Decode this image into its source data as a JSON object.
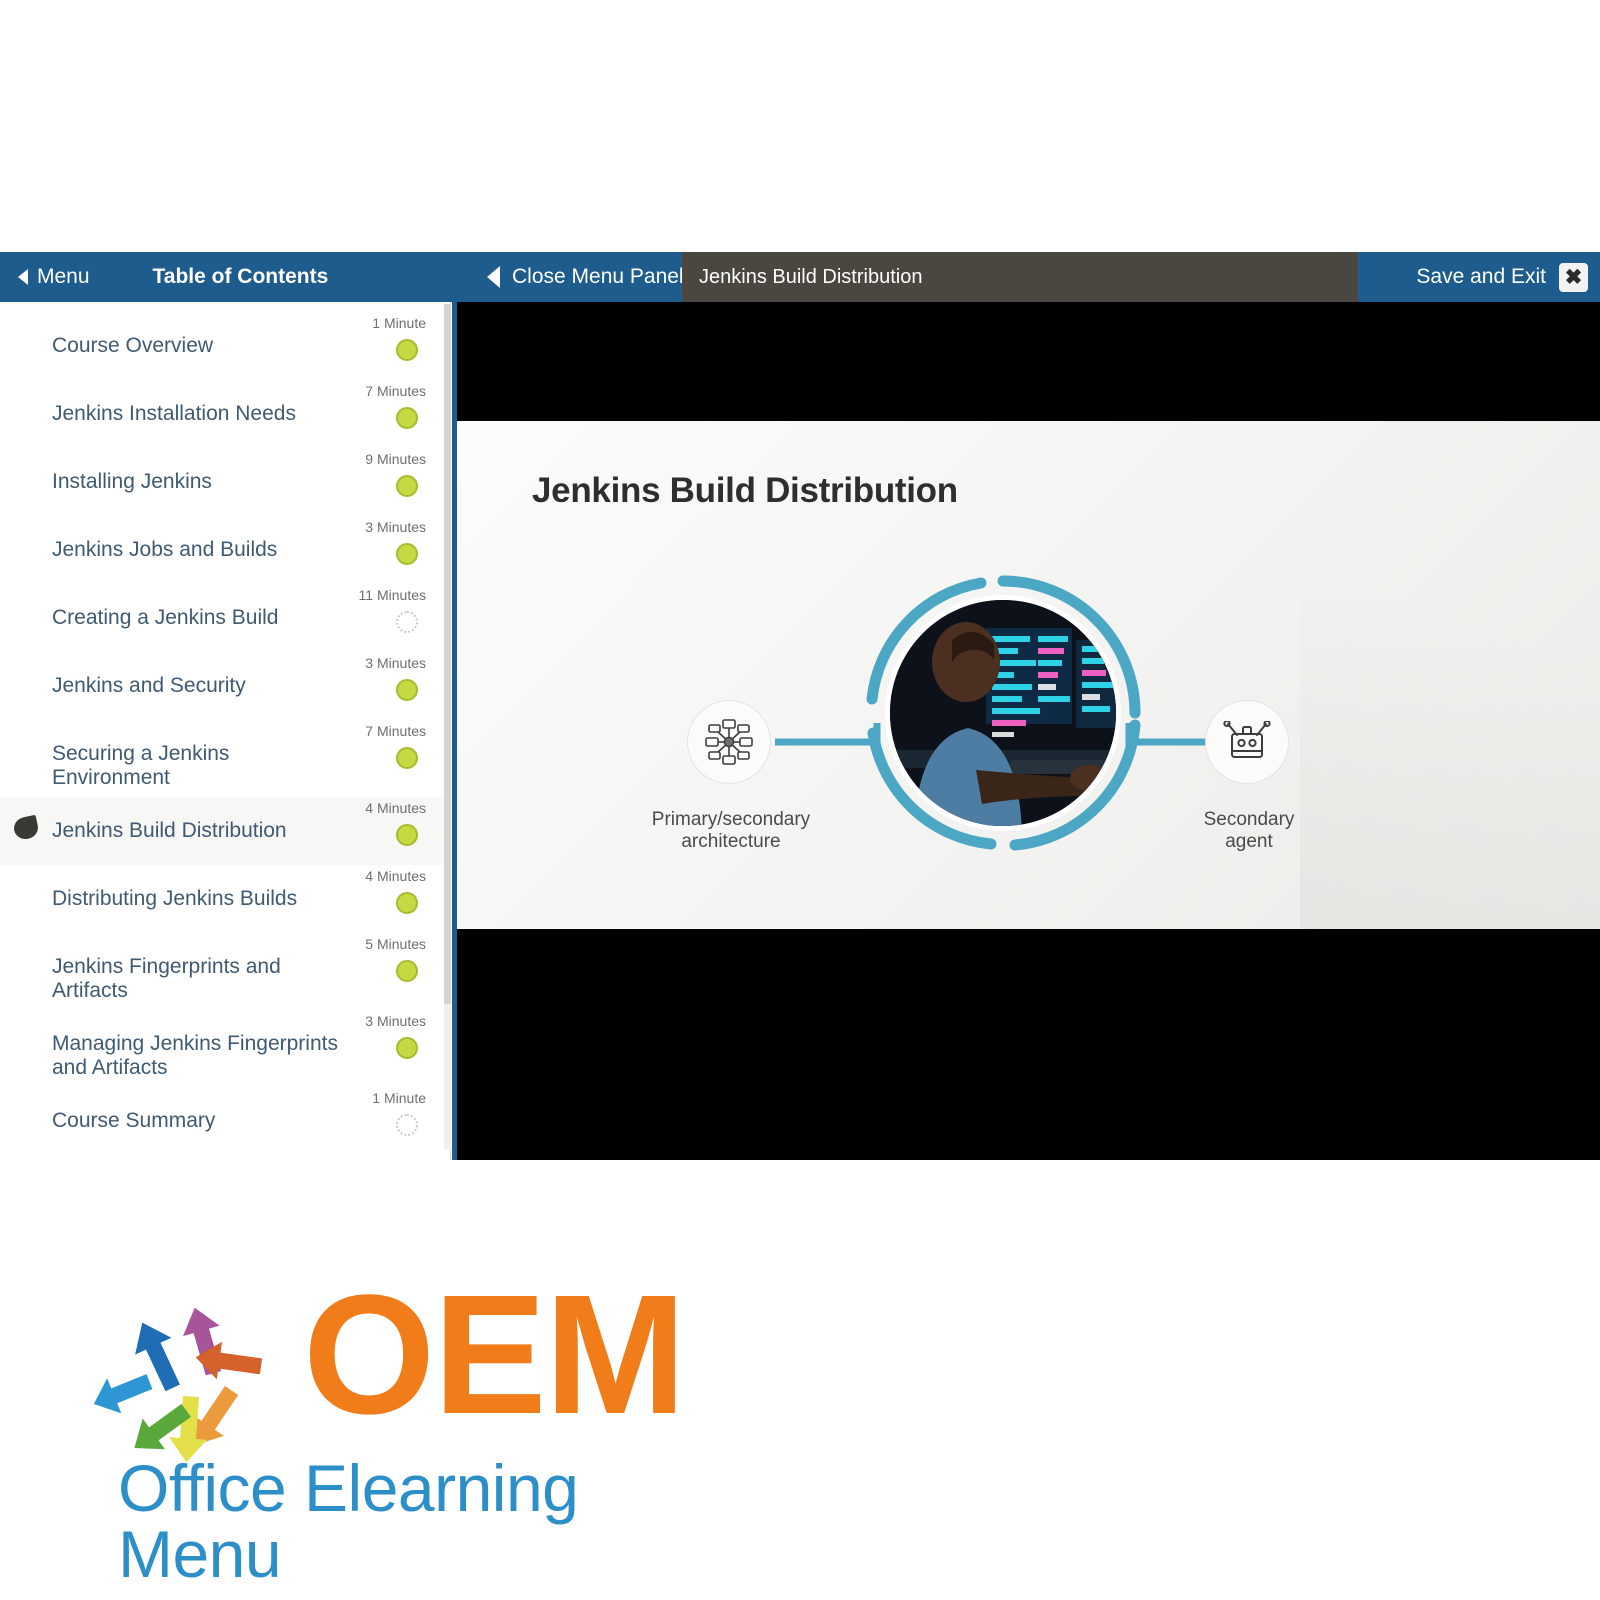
{
  "header": {
    "menu_label": "Menu",
    "toc_label": "Table of Contents",
    "close_menu_label": "Close Menu Panel",
    "slide_tab_label": "Jenkins Build Distribution",
    "save_exit_label": "Save and Exit",
    "close_icon_glyph": "✖",
    "bar_color": "#1d5c8d",
    "tab_color": "#4a4741"
  },
  "toc": {
    "items": [
      {
        "title": "Course Overview",
        "time": "1 Minute",
        "status": "done",
        "current": false
      },
      {
        "title": "Jenkins Installation Needs",
        "time": "7 Minutes",
        "status": "done",
        "current": false
      },
      {
        "title": "Installing Jenkins",
        "time": "9 Minutes",
        "status": "done",
        "current": false
      },
      {
        "title": "Jenkins Jobs and Builds",
        "time": "3 Minutes",
        "status": "done",
        "current": false
      },
      {
        "title": "Creating a Jenkins Build",
        "time": "11 Minutes",
        "status": "todo",
        "current": false
      },
      {
        "title": "Jenkins and Security",
        "time": "3 Minutes",
        "status": "done",
        "current": false
      },
      {
        "title": "Securing a Jenkins Environment",
        "time": "7 Minutes",
        "status": "done",
        "current": false
      },
      {
        "title": "Jenkins Build Distribution",
        "time": "4 Minutes",
        "status": "done",
        "current": true
      },
      {
        "title": "Distributing Jenkins Builds",
        "time": "4 Minutes",
        "status": "done",
        "current": false
      },
      {
        "title": "Jenkins Fingerprints and Artifacts",
        "time": "5 Minutes",
        "status": "done",
        "current": false
      },
      {
        "title": "Managing Jenkins Fingerprints and Artifacts",
        "time": "3 Minutes",
        "status": "done",
        "current": false
      },
      {
        "title": "Course Summary",
        "time": "1 Minute",
        "status": "todo",
        "current": false
      }
    ],
    "done_color": "#c6d942",
    "link_color": "#3f5a72"
  },
  "slide": {
    "title": "Jenkins Build Distribution",
    "nodes": [
      {
        "label": "Primary/secondary\narchitecture",
        "icon": "network-nodes-icon"
      },
      {
        "label": "Secondary\nagent",
        "icon": "robot-icon"
      }
    ],
    "center_image_alt": "developer-at-computer-photo",
    "accent_color": "#4ba7c3"
  },
  "logo": {
    "wordmark": "OEM",
    "tagline": "Office Elearning Menu",
    "wordmark_color": "#f07d1a",
    "tagline_color": "#2d8fc9",
    "arrow_colors": [
      "#1f6eb5",
      "#a8549b",
      "#d4622a",
      "#2e96d4",
      "#eb9a3e",
      "#5aa83c",
      "#e3e04a"
    ]
  }
}
